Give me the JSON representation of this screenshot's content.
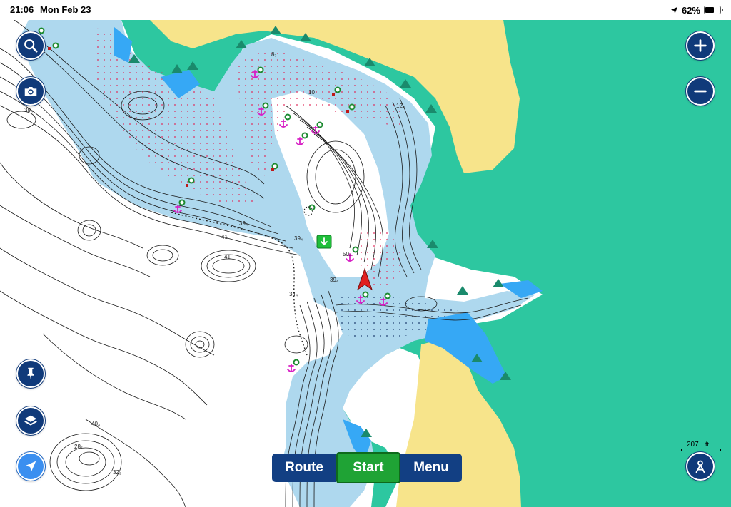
{
  "status_bar": {
    "time": "21:06",
    "date": "Mon Feb 23",
    "battery_percent": "62%",
    "battery_level": 0.62,
    "location_icon": "location-arrow-icon",
    "battery_icon": "battery-icon"
  },
  "toolbar_left": {
    "search_icon": "search-icon",
    "camera_icon": "camera-icon",
    "pin_icon": "pin-icon",
    "layers_icon": "layers-icon",
    "locate_icon": "navigation-arrow-icon"
  },
  "toolbar_right": {
    "zoom_in_icon": "plus-icon",
    "zoom_out_icon": "minus-icon",
    "autopilot_icon": "autopilot-icon"
  },
  "bottom_bar": {
    "route_label": "Route",
    "start_label": "Start",
    "menu_label": "Menu"
  },
  "scale": {
    "value": "207",
    "unit": "ft"
  },
  "depth_labels": [
    {
      "text": "39₄"
    },
    {
      "text": "41"
    },
    {
      "text": "39₄"
    },
    {
      "text": "39₄"
    },
    {
      "text": "41"
    },
    {
      "text": "50₄"
    },
    {
      "text": "34₄"
    },
    {
      "text": "39₄"
    },
    {
      "text": "40₄"
    },
    {
      "text": "28₇"
    },
    {
      "text": "32₉"
    },
    {
      "text": "8₇"
    },
    {
      "text": "10"
    },
    {
      "text": "12₄"
    }
  ],
  "colors": {
    "land": "#2dc7a0",
    "shore": "#f7e48b",
    "shallow": "#aed8ee",
    "very_shallow": "#36a8f5",
    "deep": "#ffffff",
    "button": "#103a7a",
    "start": "#1fa335",
    "vessel": "#e02020",
    "anchor": "#d71fc4",
    "waypoint": "#1fbf3a"
  },
  "map_markers": {
    "vessel_icon": "vessel-arrow-icon",
    "anchor_icon": "anchorage-icon",
    "waypoint_icon": "waypoint-flag-icon"
  }
}
